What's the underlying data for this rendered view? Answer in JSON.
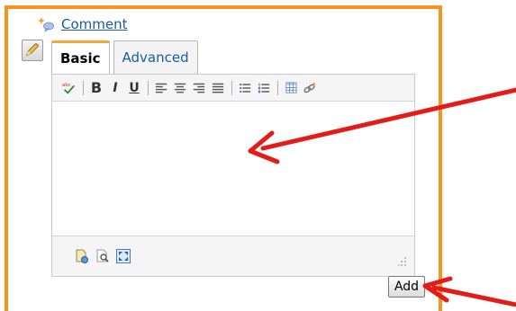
{
  "comment": {
    "label": "Comment",
    "icon": "sparkle-comment-icon"
  },
  "tabs": [
    {
      "label": "Basic",
      "active": true
    },
    {
      "label": "Advanced",
      "active": false
    }
  ],
  "toolbar": {
    "spellcheck_icon": "spellcheck-icon",
    "bold": "B",
    "italic": "I",
    "underline": "U",
    "items": [
      "spellcheck",
      "bold",
      "italic",
      "underline",
      "align-left",
      "align-center",
      "align-right",
      "align-justify",
      "bullet-list",
      "numbered-list",
      "insert-table",
      "link"
    ]
  },
  "editor": {
    "content": ""
  },
  "footer_tools": [
    "insert-file",
    "preview",
    "fullscreen"
  ],
  "add_button": {
    "label": "Add"
  },
  "colors": {
    "frame": "#f7931e",
    "link": "#1a5aa6",
    "arrow": "#e41b17",
    "active_tab_top": "#f7a43a"
  }
}
